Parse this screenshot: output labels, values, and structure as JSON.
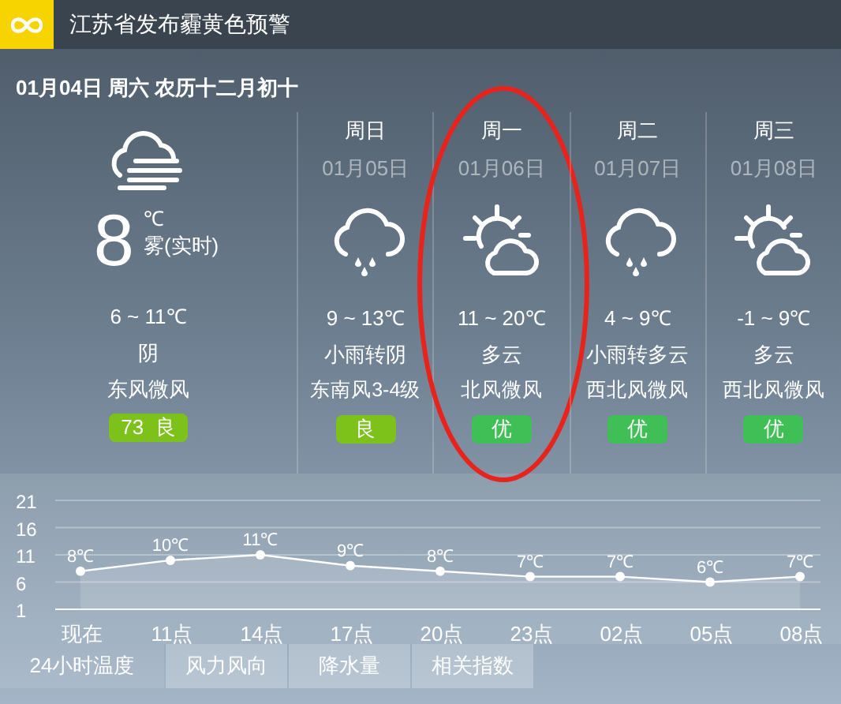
{
  "alert": {
    "title": "江苏省发布霾黄色预警"
  },
  "date_line": "01月04日 周六 农历十二月初十",
  "today": {
    "kind": "fog",
    "temperature": "8",
    "unit": "℃",
    "condition": "雾(实时)",
    "range": "6 ~ 11℃",
    "weather": "阴",
    "wind": "东风微风",
    "aqi": {
      "label": "73  良",
      "color": "#7cc21b"
    }
  },
  "days": [
    {
      "weekday": "周日",
      "date": "01月05日",
      "kind": "rain",
      "range": "9 ~ 13℃",
      "weather": "小雨转阴",
      "wind": "东南风3-4级",
      "aqi": {
        "label": "良",
        "color": "#7cc21b"
      },
      "circled": false
    },
    {
      "weekday": "周一",
      "date": "01月06日",
      "kind": "partly_cloudy",
      "range": "11 ~ 20℃",
      "weather": "多云",
      "wind": "北风微风",
      "aqi": {
        "label": "优",
        "color": "#3fbf55"
      },
      "circled": true
    },
    {
      "weekday": "周二",
      "date": "01月07日",
      "kind": "rain",
      "range": "4 ~ 9℃",
      "weather": "小雨转多云",
      "wind": "西北风微风",
      "aqi": {
        "label": "优",
        "color": "#3fbf55"
      },
      "circled": false
    },
    {
      "weekday": "周三",
      "date": "01月08日",
      "kind": "partly_cloudy",
      "range": "-1 ~ 9℃",
      "weather": "多云",
      "wind": "西北风微风",
      "aqi": {
        "label": "优",
        "color": "#3fbf55"
      },
      "circled": false
    }
  ],
  "chart_data": {
    "type": "area",
    "categories": [
      "现在",
      "11点",
      "14点",
      "17点",
      "20点",
      "23点",
      "02点",
      "05点",
      "08点"
    ],
    "series": [
      {
        "color": "#ffffff",
        "marker": true,
        "values": [
          8,
          10,
          11,
          9,
          8,
          7,
          7,
          6,
          7
        ]
      }
    ],
    "grid": true,
    "value_labels": [
      "8℃",
      "10℃",
      "11℃",
      "9℃",
      "8℃",
      "7℃",
      "7℃",
      "6℃",
      "7℃"
    ],
    "ylim": [
      1,
      21
    ],
    "yticks": [
      1,
      6,
      11,
      16,
      21
    ]
  },
  "tabs": [
    {
      "label": "24小时温度",
      "selected": true
    },
    {
      "label": "风力风向",
      "selected": false
    },
    {
      "label": "降水量",
      "selected": false
    },
    {
      "label": "相关指数",
      "selected": false
    }
  ]
}
